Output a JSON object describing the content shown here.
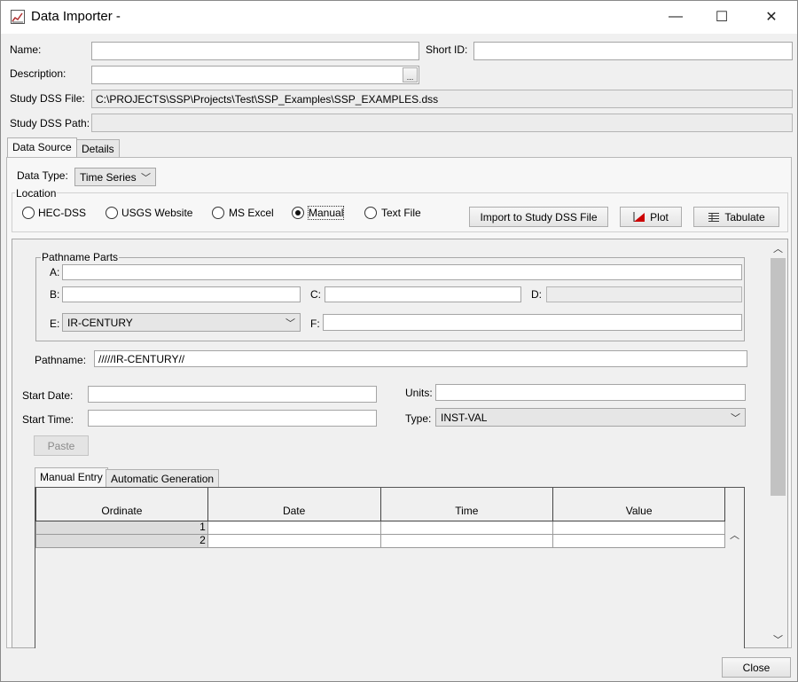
{
  "window": {
    "title": "Data Importer -"
  },
  "controls": {
    "minimize": "—",
    "maximize": "☐",
    "close": "✕"
  },
  "form": {
    "name_label": "Name:",
    "name_value": "",
    "short_id_label": "Short ID:",
    "short_id_value": "",
    "description_label": "Description:",
    "description_value": "",
    "browse_glyph": "...",
    "study_dss_file_label": "Study DSS File:",
    "study_dss_file_value": "C:\\PROJECTS\\SSP\\Projects\\Test\\SSP_Examples\\SSP_EXAMPLES.dss",
    "study_dss_path_label": "Study DSS Path:",
    "study_dss_path_value": ""
  },
  "tabs": {
    "data_source": "Data Source",
    "details": "Details"
  },
  "data_source": {
    "data_type_label": "Data Type:",
    "data_type_value": "Time Series",
    "location_label": "Location",
    "options": [
      "HEC-DSS",
      "USGS Website",
      "MS Excel",
      "Manual",
      "Text File"
    ],
    "selected": "Manual",
    "import_button": "Import to Study DSS File",
    "plot_button": "Plot",
    "tabulate_button": "Tabulate"
  },
  "pathname_parts": {
    "group_label": "Pathname Parts",
    "a_label": "A:",
    "a_value": "",
    "b_label": "B:",
    "b_value": "",
    "c_label": "C:",
    "c_value": "",
    "d_label": "D:",
    "d_value": "",
    "e_label": "E:",
    "e_value": "IR-CENTURY",
    "f_label": "F:",
    "f_value": ""
  },
  "pathname": {
    "label": "Pathname:",
    "value": "/////IR-CENTURY//"
  },
  "time_fields": {
    "start_date_label": "Start Date:",
    "start_date_value": "",
    "start_time_label": "Start Time:",
    "start_time_value": "",
    "units_label": "Units:",
    "units_value": "",
    "type_label": "Type:",
    "type_value": "INST-VAL",
    "paste_button": "Paste"
  },
  "entry_tabs": {
    "manual": "Manual Entry",
    "automatic": "Automatic Generation"
  },
  "table": {
    "columns": [
      "Ordinate",
      "Date",
      "Time",
      "Value"
    ],
    "rows": [
      {
        "ordinate": "1",
        "date": "",
        "time": "",
        "value": ""
      },
      {
        "ordinate": "2",
        "date": "",
        "time": "",
        "value": ""
      }
    ]
  },
  "footer": {
    "close_button": "Close"
  },
  "colors": {
    "window_bg": "#f0f0f0",
    "field_bg": "#ffffff",
    "readonly_bg": "#ececec",
    "plot_icon": "#cc0000"
  }
}
